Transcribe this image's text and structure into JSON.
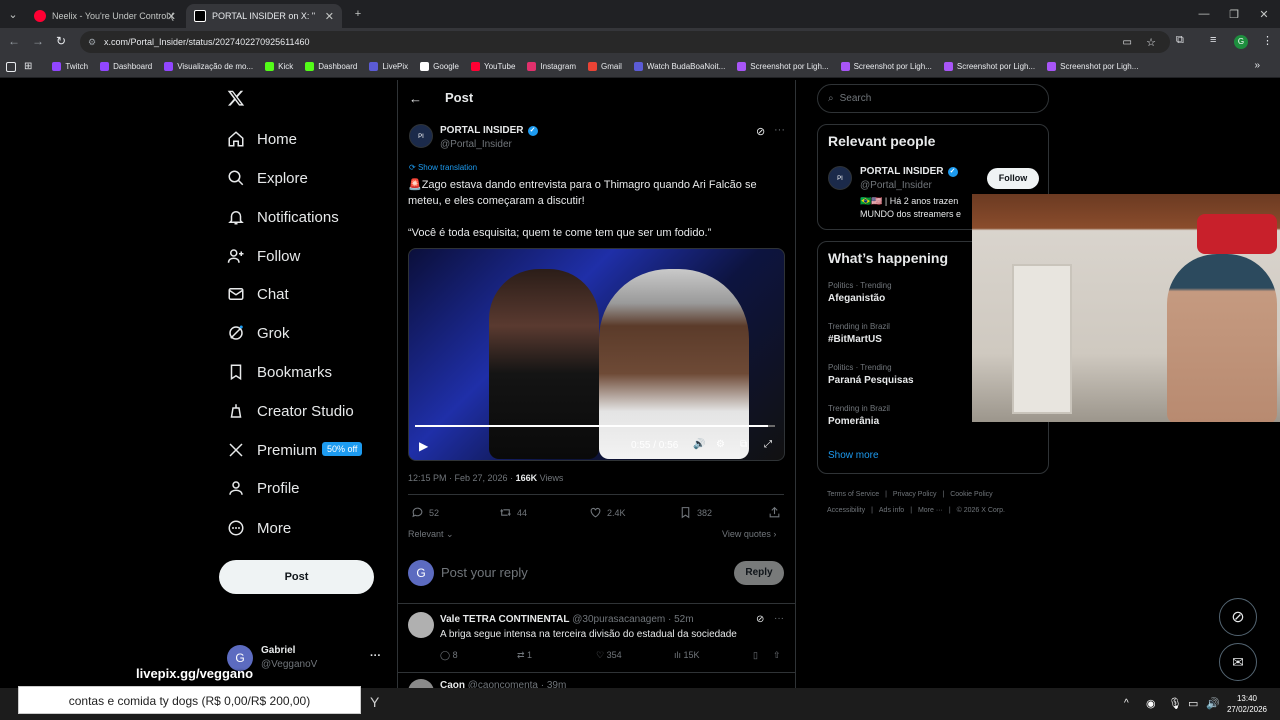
{
  "browser": {
    "tabs": [
      {
        "title": "Neelix - You're Under Control (",
        "favicon_color": "#ff0033"
      },
      {
        "title": "PORTAL INSIDER on X: \"",
        "favicon_color": "#ffffff"
      }
    ],
    "new_tab": "+",
    "url": "x.com/Portal_Insider/status/2027402270925611460",
    "bookmarks": [
      {
        "label": "Twitch",
        "color": "#9146ff"
      },
      {
        "label": "Dashboard",
        "color": "#9146ff"
      },
      {
        "label": "Visualização de mo...",
        "color": "#9146ff"
      },
      {
        "label": "Kick",
        "color": "#53fc18"
      },
      {
        "label": "Dashboard",
        "color": "#53fc18"
      },
      {
        "label": "LivePix",
        "color": "#5b5bd6"
      },
      {
        "label": "Google",
        "color": "#ffffff"
      },
      {
        "label": "YouTube",
        "color": "#ff0033"
      },
      {
        "label": "Instagram",
        "color": "#e1306c"
      },
      {
        "label": "Gmail",
        "color": "#ea4335"
      },
      {
        "label": "Watch BudaBoaNoit...",
        "color": "#5b5bd6"
      },
      {
        "label": "Screenshot por Ligh...",
        "color": "#a855f7"
      },
      {
        "label": "Screenshot por Ligh...",
        "color": "#a855f7"
      },
      {
        "label": "Screenshot por Ligh...",
        "color": "#a855f7"
      },
      {
        "label": "Screenshot por Ligh...",
        "color": "#a855f7"
      }
    ],
    "more_bookmarks": "»"
  },
  "sidebar": {
    "nav": [
      {
        "label": "Home",
        "icon": "home-icon"
      },
      {
        "label": "Explore",
        "icon": "search-icon"
      },
      {
        "label": "Notifications",
        "icon": "bell-icon"
      },
      {
        "label": "Follow",
        "icon": "person-plus-icon"
      },
      {
        "label": "Chat",
        "icon": "envelope-icon"
      },
      {
        "label": "Grok",
        "icon": "grok-icon"
      },
      {
        "label": "Bookmarks",
        "icon": "bookmark-icon"
      },
      {
        "label": "Creator Studio",
        "icon": "creator-icon"
      },
      {
        "label": "Premium",
        "icon": "x-logo-icon"
      },
      {
        "label": "Profile",
        "icon": "person-icon"
      },
      {
        "label": "More",
        "icon": "more-circle-icon"
      }
    ],
    "premium_badge": "50% off",
    "post_button": "Post",
    "account": {
      "name": "Gabriel",
      "handle": "@VegganoV",
      "initial": "G",
      "more": "···"
    }
  },
  "post": {
    "header": "Post",
    "author": {
      "name": "PORTAL INSIDER",
      "handle": "@Portal_Insider"
    },
    "show_translation": "Show translation",
    "text_line1": "🚨Zago estava dando entrevista para o Thimagro quando Ari Falcão se meteu, e eles começaram a discutir!",
    "text_quote": "“Você é toda esquisita; quem te come tem que ser um fodido.”",
    "video": {
      "time": "0:55 / 0:56",
      "progress": 0.98
    },
    "meta_time": "12:15 PM · Feb 27, 2026 · ",
    "meta_views": "166K",
    "meta_views_label": " Views",
    "stats": {
      "replies": "52",
      "reposts": "44",
      "likes": "2.4K",
      "bookmarks": "382"
    },
    "sort": "Relevant",
    "view_quotes": "View quotes",
    "reply_placeholder": "Post your reply",
    "reply_button": "Reply",
    "reply_avatar": "G"
  },
  "replies": [
    {
      "name": "Vale TETRA CONTINENTAL",
      "handle": "@30purasacanagem · 52m",
      "text": "A briga segue intensa na terceira divisão do estadual da sociedade",
      "replies": "8",
      "reposts": "1",
      "likes": "354",
      "views": "15K"
    },
    {
      "name": "Caon",
      "handle": "@caoncomenta · 39m"
    }
  ],
  "right": {
    "search_placeholder": "Search",
    "relevant_title": "Relevant people",
    "relevant_person": {
      "name": "PORTAL INSIDER",
      "handle": "@Portal_Insider",
      "bio": "🇧🇷🇺🇸 | Há 2 anos trazen MUNDO dos streamers e",
      "follow": "Follow"
    },
    "happening_title": "What’s happening",
    "trends": [
      {
        "category": "Politics · Trending",
        "name": "Afeganistão"
      },
      {
        "category": "Trending in Brazil",
        "name": "#BitMartUS"
      },
      {
        "category": "Politics · Trending",
        "name": "Paraná Pesquisas"
      },
      {
        "category": "Trending in Brazil",
        "name": "Pomerânia"
      }
    ],
    "show_more": "Show more",
    "footer_row1": [
      "Terms of Service",
      "Privacy Policy",
      "Cookie Policy"
    ],
    "footer_row2": [
      "Accessibility",
      "Ads info",
      "More ···",
      "© 2026 X Corp."
    ]
  },
  "overlay": {
    "livepix_url": "livepix.gg/veggano",
    "goal_text": "contas e comida ty dogs (R$ 0,00/R$ 200,00)"
  },
  "taskbar": {
    "time": "13:40",
    "date": "27/02/2026"
  },
  "colors": {
    "accent": "#1d9bf0",
    "premium": "#1d9bf0",
    "bg": "#000000",
    "border": "#2f3336"
  }
}
